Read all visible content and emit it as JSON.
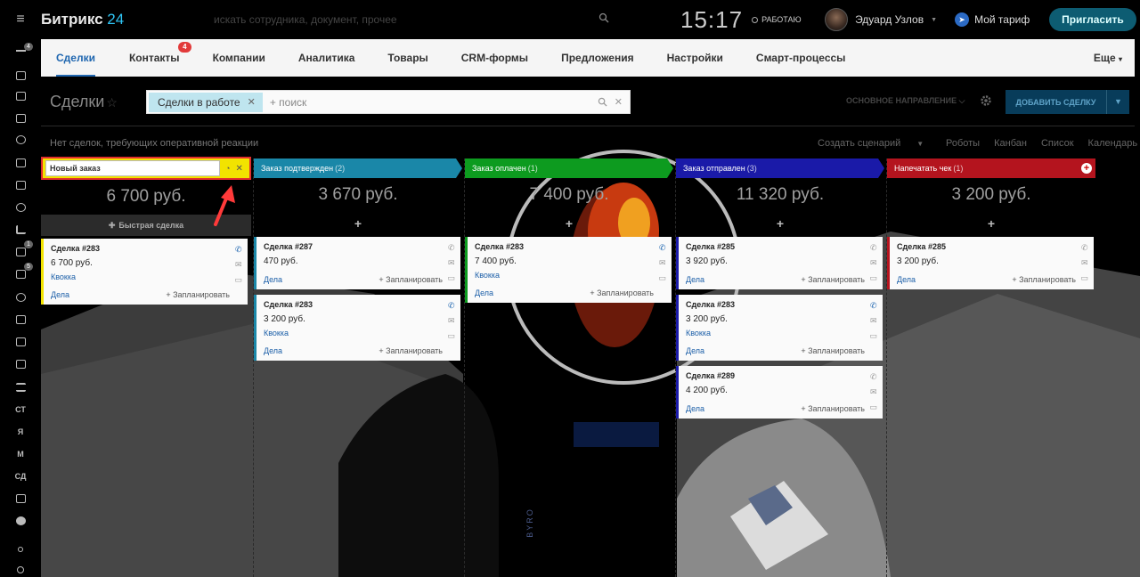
{
  "topbar": {
    "logo_a": "Битрикс",
    "logo_b": " 24",
    "search_placeholder": "искать сотрудника, документ, прочее",
    "clock": "15:17",
    "status": "РАБОТАЮ",
    "user_name": "Эдуард Узлов",
    "tariff": "Мой тариф",
    "invite": "Пригласить"
  },
  "leftbar": {
    "badges": [
      "4",
      "1",
      "5"
    ],
    "texts": [
      "СТ",
      "Я",
      "М",
      "СД"
    ]
  },
  "tabs": {
    "items": [
      "Сделки",
      "Контакты",
      "Компании",
      "Аналитика",
      "Товары",
      "CRM-формы",
      "Предложения",
      "Настройки",
      "Смарт-процессы"
    ],
    "contacts_badge": "4",
    "more": "Еще"
  },
  "page": {
    "title": "Сделки",
    "filter_chip": "Сделки в работе",
    "filter_placeholder": "+ поиск",
    "direction": "ОСНОВНОЕ НАПРАВЛЕНИЕ",
    "add_button": "ДОБАВИТЬ СДЕЛКУ",
    "no_reaction": "Нет сделок, требующих оперативной реакции",
    "create_scenario": "Создать сценарий",
    "views": [
      "Роботы",
      "Канбан",
      "Список",
      "Календарь"
    ]
  },
  "columns": [
    {
      "stage_input": "Новый заказ",
      "color": "#f2e300",
      "sum": "6 700 руб.",
      "quick": "Быстрая сделка",
      "cards": [
        {
          "title": "Сделка #283",
          "amount": "6 700 руб.",
          "client": "Квокка",
          "deals": "Дела",
          "plan": "+ Запланировать"
        }
      ]
    },
    {
      "stage": "Заказ подтвержден",
      "count": "(2)",
      "color": "#1a87a8",
      "sum": "3 670 руб.",
      "plus": "+",
      "cards": [
        {
          "title": "Сделка #287",
          "amount": "470 руб.",
          "client": "",
          "deals": "Дела",
          "plan": "+ Запланировать"
        },
        {
          "title": "Сделка #283",
          "amount": "3 200 руб.",
          "client": "Квокка",
          "deals": "Дела",
          "plan": "+ Запланировать"
        }
      ]
    },
    {
      "stage": "Заказ оплачен",
      "count": "(1)",
      "color": "#0d9b1f",
      "sum": "7 400 руб.",
      "plus": "+",
      "cards": [
        {
          "title": "Сделка #283",
          "amount": "7 400 руб.",
          "client": "Квокка",
          "deals": "Дела",
          "plan": "+ Запланировать"
        }
      ]
    },
    {
      "stage": "Заказ отправлен",
      "count": "(3)",
      "color": "#1a1aa8",
      "sum": "11 320 руб.",
      "plus": "+",
      "cards": [
        {
          "title": "Сделка #285",
          "amount": "3 920 руб.",
          "client": "",
          "deals": "Дела",
          "plan": "+ Запланировать"
        },
        {
          "title": "Сделка #283",
          "amount": "3 200 руб.",
          "client": "Квокка",
          "deals": "Дела",
          "plan": "+ Запланировать"
        },
        {
          "title": "Сделка #289",
          "amount": "4 200 руб.",
          "client": "",
          "deals": "Дела",
          "plan": "+ Запланировать"
        }
      ]
    },
    {
      "stage": "Напечатать чек",
      "count": "(1)",
      "color": "#b4141e",
      "sum": "3 200 руб.",
      "plus": "+",
      "cards": [
        {
          "title": "Сделка #285",
          "amount": "3 200 руб.",
          "client": "",
          "deals": "Дела",
          "plan": "+ Запланировать"
        }
      ]
    }
  ],
  "background_text": "BYRO",
  "colors": {
    "accent": "#2067b0",
    "highlight": "#e12d2d"
  }
}
